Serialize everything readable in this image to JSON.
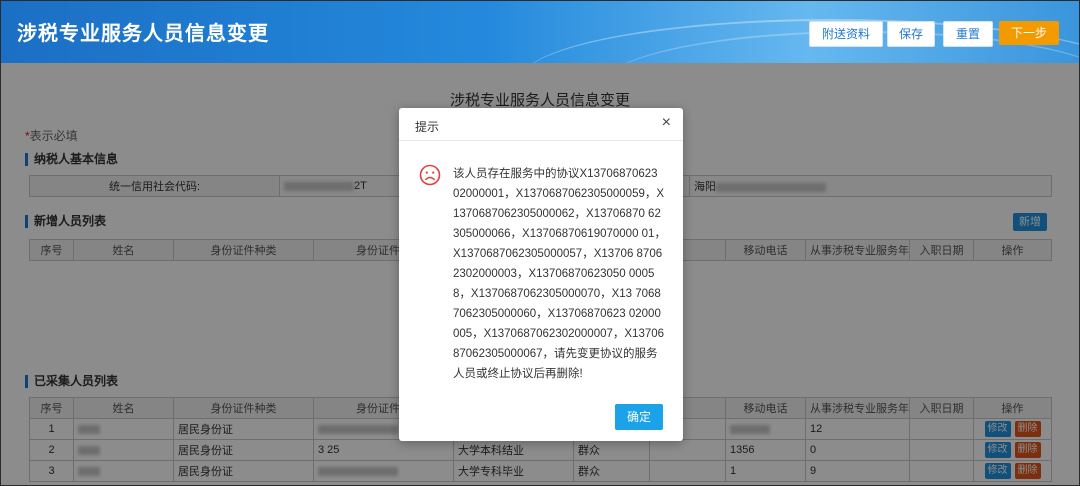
{
  "header": {
    "title": "涉税专业服务人员信息变更",
    "buttons": {
      "attach": "附送资料",
      "save": "保存",
      "reset": "重置",
      "next": "下一步"
    }
  },
  "main": {
    "page_heading": "涉税专业服务人员信息变更",
    "required_note": {
      "star": "*",
      "text": "表示必填"
    },
    "taxpayer_section": {
      "title": "纳税人基本信息",
      "uscc_label": "统一信用社会代码:",
      "uscc_value_suffix": "2T",
      "name_prefix": "海阳"
    },
    "new_section": {
      "title": "新增人员列表",
      "add_button": "新增",
      "columns": [
        "序号",
        "姓名",
        "身份证件种类",
        "身份证件号",
        "",
        "",
        "",
        "移动电话",
        "从事涉税专业服务年限",
        "入职日期",
        "操作"
      ]
    },
    "collected_section": {
      "title": "已采集人员列表",
      "columns": [
        "序号",
        "姓名",
        "身份证件种类",
        "身份证件号",
        "",
        "",
        "",
        "移动电话",
        "从事涉税专业服务年限",
        "入职日期",
        "操作"
      ],
      "rows": [
        {
          "idx": "1",
          "id_type": "居民身份证",
          "id_no": "",
          "edu": "",
          "politics": "",
          "phone": "",
          "years": "12"
        },
        {
          "idx": "2",
          "id_type": "居民身份证",
          "id_no": "3 25",
          "edu": "大学本科结业",
          "politics": "群众",
          "phone": "1356",
          "years": "0"
        },
        {
          "idx": "3",
          "id_type": "居民身份证",
          "id_no": "",
          "edu": "大学专科毕业",
          "politics": "群众",
          "phone": "1",
          "years": "9"
        }
      ],
      "edit_label": "修改",
      "delete_label": "删除"
    }
  },
  "dialog": {
    "title": "提示",
    "close": "×",
    "icon": "sad-face-icon",
    "message": "该人员存在服务中的协议X13706870623 02000001，X1370687062305000059，X1370687062305000062，X13706870 62305000066，X13706870619070000 01，X1370687062305000057，X13706 87062302000003，X13706870623050 00058，X1370687062305000070，X13 70687062305000060，X13706870623 02000005，X1370687062302000007，X1370687062305000067，请先变更协议的服务人员或终止协议后再删除!",
    "ok": "确定"
  },
  "colors": {
    "header": "#2489dc",
    "orange": "#f39a00",
    "dialog_ok": "#1aa3e8",
    "danger": "#e1561b"
  }
}
